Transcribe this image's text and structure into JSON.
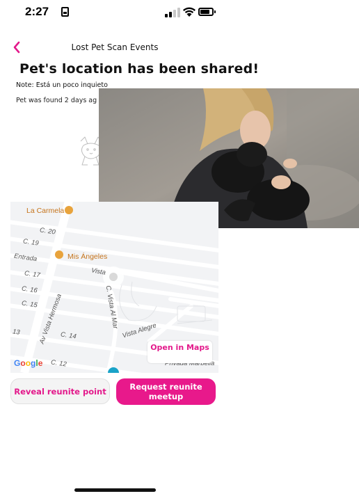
{
  "status_bar": {
    "time": "2:27"
  },
  "nav": {
    "back_icon": "chevron-left-icon",
    "title": "Lost Pet Scan Events"
  },
  "page": {
    "heading": "Pet's location has been shared!",
    "note": "Note: Está un poco inquieto",
    "found_text": "Pet was found 2 days ag"
  },
  "map": {
    "streets": [
      "C. 20",
      "C. 19",
      "Entrada",
      "C. 17",
      "C. 16",
      "C. 15",
      "13",
      "C. 14",
      "C. 12",
      "Av Vista Hermosa",
      "Vista",
      "C. Vista Al Mar",
      "Vista Alegre",
      "Privada Marbella"
    ],
    "pois": [
      "La Carmela",
      "Mis Ángeles"
    ],
    "google_label": "Google",
    "open_in_maps": "Open in Maps"
  },
  "actions": {
    "reveal_label": "Reveal reunite point",
    "request_label": "Request reunite meetup"
  },
  "colors": {
    "accent": "#e8198b",
    "poi": "#c5731a"
  }
}
